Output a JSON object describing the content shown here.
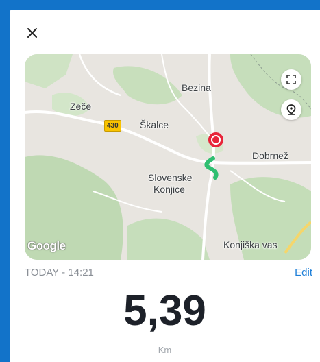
{
  "window": {
    "close_icon": "close-icon"
  },
  "map": {
    "labels": {
      "bezina": "Bezina",
      "zece": "Zeče",
      "road_number": "430",
      "skalce": "Škalce",
      "dobrnez": "Dobrnež",
      "slovenske": "Slovenske",
      "konjice": "Konjice",
      "konjiska_vas": "Konjiška vas"
    },
    "attribution": "Google",
    "buttons": {
      "expand_icon": "expand-icon",
      "location_icon": "location-pin-icon"
    },
    "colors": {
      "route": "#2fbf71",
      "start_marker": "#e8253a"
    }
  },
  "activity": {
    "date": "TODAY - 14:21",
    "edit_label": "Edit",
    "distance": "5,39",
    "unit": "Km"
  }
}
